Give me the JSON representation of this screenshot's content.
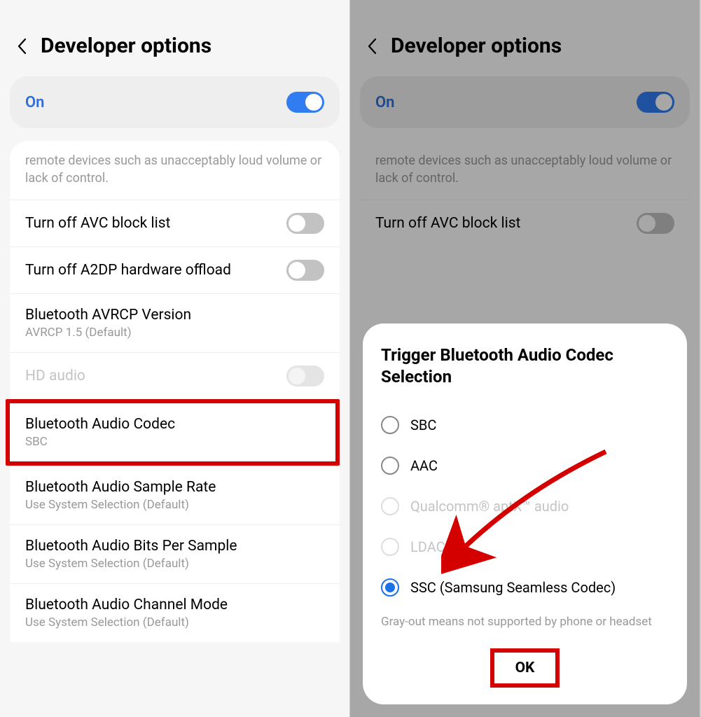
{
  "left": {
    "header": {
      "title": "Developer options"
    },
    "master_toggle": {
      "label": "On",
      "state": "on"
    },
    "partial_desc": "remote devices such as unacceptably loud volume or lack of control.",
    "rows": {
      "avc": {
        "title": "Turn off AVC block list",
        "toggle": "off"
      },
      "a2dp": {
        "title": "Turn off A2DP hardware offload",
        "toggle": "off"
      },
      "avrcp": {
        "title": "Bluetooth AVRCP Version",
        "subtitle": "AVRCP 1.5 (Default)"
      },
      "hd_audio": {
        "title": "HD audio",
        "toggle": "disabled"
      },
      "codec": {
        "title": "Bluetooth Audio Codec",
        "subtitle": "SBC"
      },
      "sample_rate": {
        "title": "Bluetooth Audio Sample Rate",
        "subtitle": "Use System Selection (Default)"
      },
      "bits": {
        "title": "Bluetooth Audio Bits Per Sample",
        "subtitle": "Use System Selection (Default)"
      },
      "channel": {
        "title": "Bluetooth Audio Channel Mode",
        "subtitle": "Use System Selection (Default)"
      }
    }
  },
  "right": {
    "header": {
      "title": "Developer options"
    },
    "master_toggle": {
      "label": "On",
      "state": "on"
    },
    "partial_desc": "remote devices such as unacceptably loud volume or lack of control.",
    "rows": {
      "avc": {
        "title": "Turn off AVC block list",
        "toggle": "off"
      }
    },
    "dialog": {
      "title": "Trigger Bluetooth Audio Codec Selection",
      "options": [
        {
          "label": "SBC",
          "state": "enabled",
          "selected": false
        },
        {
          "label": "AAC",
          "state": "enabled",
          "selected": false
        },
        {
          "label": "Qualcomm® aptX™ audio",
          "state": "disabled",
          "selected": false
        },
        {
          "label": "LDAC",
          "state": "disabled",
          "selected": false
        },
        {
          "label": "SSC (Samsung Seamless Codec)",
          "state": "enabled",
          "selected": true
        }
      ],
      "note": "Gray-out means not supported by phone or headset",
      "ok": "OK"
    }
  }
}
